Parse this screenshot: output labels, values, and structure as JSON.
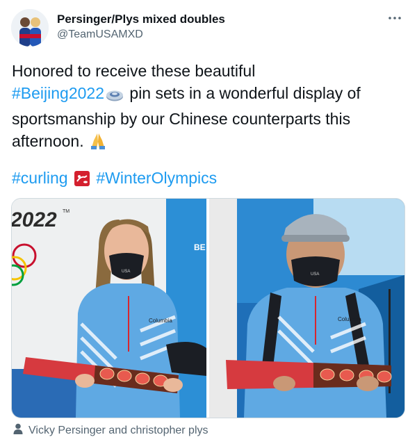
{
  "author": {
    "display_name": "Persinger/Plys mixed doubles",
    "handle": "@TeamUSAMXD",
    "avatar_icon": "team-usa-avatar-icon"
  },
  "menu": {
    "icon": "more-horizontal-icon"
  },
  "tweet": {
    "line1": "Honored to receive these beautiful",
    "hashtag_beijing": "#Beijing2022",
    "line2_rest": " pin sets in a wonderful display of",
    "line3": "sportsmanship by our Chinese counterparts this",
    "line4": "afternoon.",
    "hashtag_curling": "#curling",
    "hashtag_olympics": "#WinterOlympics",
    "emojis": [
      "curling-stone-emoji",
      "folded-hands-emoji",
      "curling-pictogram-emoji"
    ]
  },
  "media": {
    "photos": [
      {
        "icon": "photo-woman-holding-pin-set",
        "signage": "2022",
        "trademark": "TM",
        "sign_partial": "BE",
        "jacket_brand": "Columbia",
        "mask_text": "USA"
      },
      {
        "icon": "photo-man-holding-pin-set",
        "jacket_brand": "Columbia",
        "mask_text": "USA"
      }
    ]
  },
  "tagged": {
    "icon": "person-icon",
    "text": "Vicky Persinger and christopher plys"
  },
  "colors": {
    "accent": "#1d9bf0",
    "text": "#0f1419",
    "secondary": "#536471",
    "border": "#cfd9de"
  }
}
